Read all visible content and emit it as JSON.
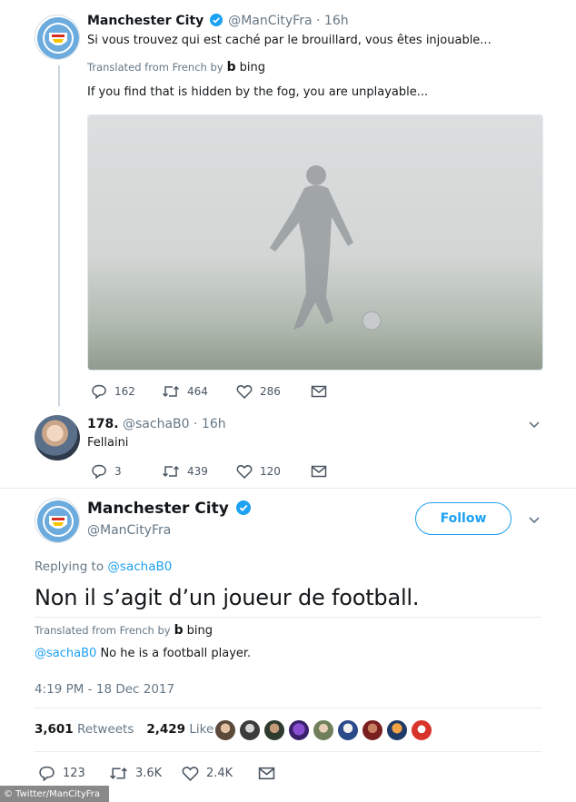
{
  "tweet1": {
    "name": "Manchester City",
    "handle": "@ManCityFra",
    "dot": "·",
    "time": "16h",
    "text": "Si vous trouvez qui est caché par le brouillard, vous êtes injouable...",
    "translated_label": "Translated from French by",
    "bing_label": "bing",
    "translation": "If you find that is hidden by the fog, you are unplayable...",
    "replies": "162",
    "retweets": "464",
    "likes": "286"
  },
  "tweet2": {
    "name": "178.",
    "handle": "@sachaB0",
    "dot": "·",
    "time": "16h",
    "text": "Fellaini",
    "replies": "3",
    "retweets": "439",
    "likes": "120"
  },
  "main_tweet": {
    "name": "Manchester City",
    "handle": "@ManCityFra",
    "follow_label": "Follow",
    "replying_label": "Replying to",
    "replying_to": "@sachaB0",
    "text": "Non il s’agit d’un joueur de football.",
    "translated_label": "Translated from French by",
    "bing_label": "bing",
    "translation_mention": "@sachaB0",
    "translation_text": "No he is a football player.",
    "timestamp": "4:19 PM - 18 Dec 2017",
    "retweets_count": "3,601",
    "retweets_label": "Retweets",
    "likes_count": "2,429",
    "likes_label": "Likes",
    "replies": "123",
    "retweets": "3.6K",
    "likes": "2.4K"
  },
  "credit": "© Twitter/ManCityFra",
  "colors": {
    "accent": "#1da1f2",
    "city_blue": "#6cabdd",
    "text_secondary": "#657786"
  },
  "icons": {
    "verified": "verified-badge-icon",
    "reply": "reply-icon",
    "retweet": "retweet-icon",
    "like": "heart-icon",
    "dm": "envelope-icon",
    "more": "chevron-down-icon",
    "bing": "bing-logo-icon"
  }
}
